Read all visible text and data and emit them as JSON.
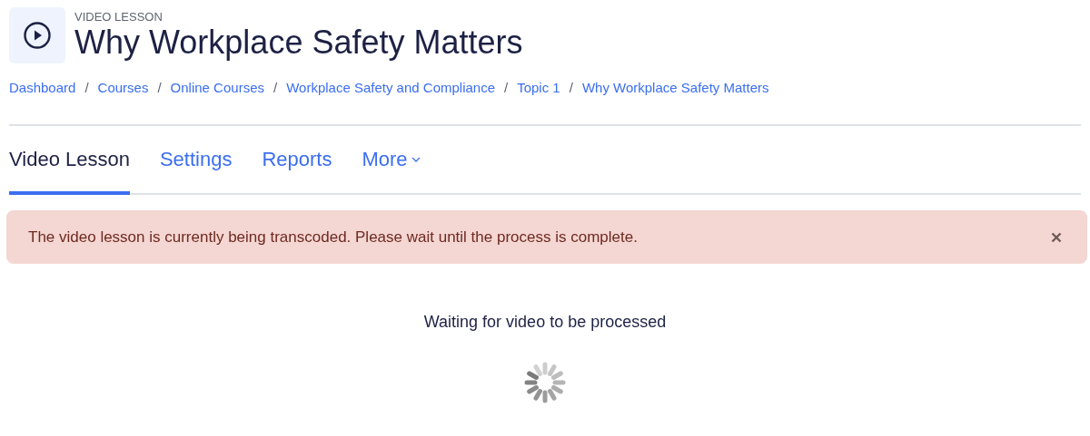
{
  "header": {
    "eyebrow": "VIDEO LESSON",
    "title": "Why Workplace Safety Matters"
  },
  "breadcrumb_separator": "/",
  "breadcrumb": [
    "Dashboard",
    "Courses",
    "Online Courses",
    "Workplace Safety and Compliance",
    "Topic 1",
    "Why Workplace Safety Matters"
  ],
  "tabs": [
    {
      "label": "Video Lesson",
      "selected": true,
      "kind": "link"
    },
    {
      "label": "Settings",
      "selected": false,
      "kind": "link"
    },
    {
      "label": "Reports",
      "selected": false,
      "kind": "link"
    },
    {
      "label": "More",
      "selected": false,
      "kind": "dropdown"
    }
  ],
  "alert": {
    "message": "The video lesson is currently being transcoded. Please wait until the process is complete."
  },
  "status": {
    "message": "Waiting for video to be processed"
  }
}
